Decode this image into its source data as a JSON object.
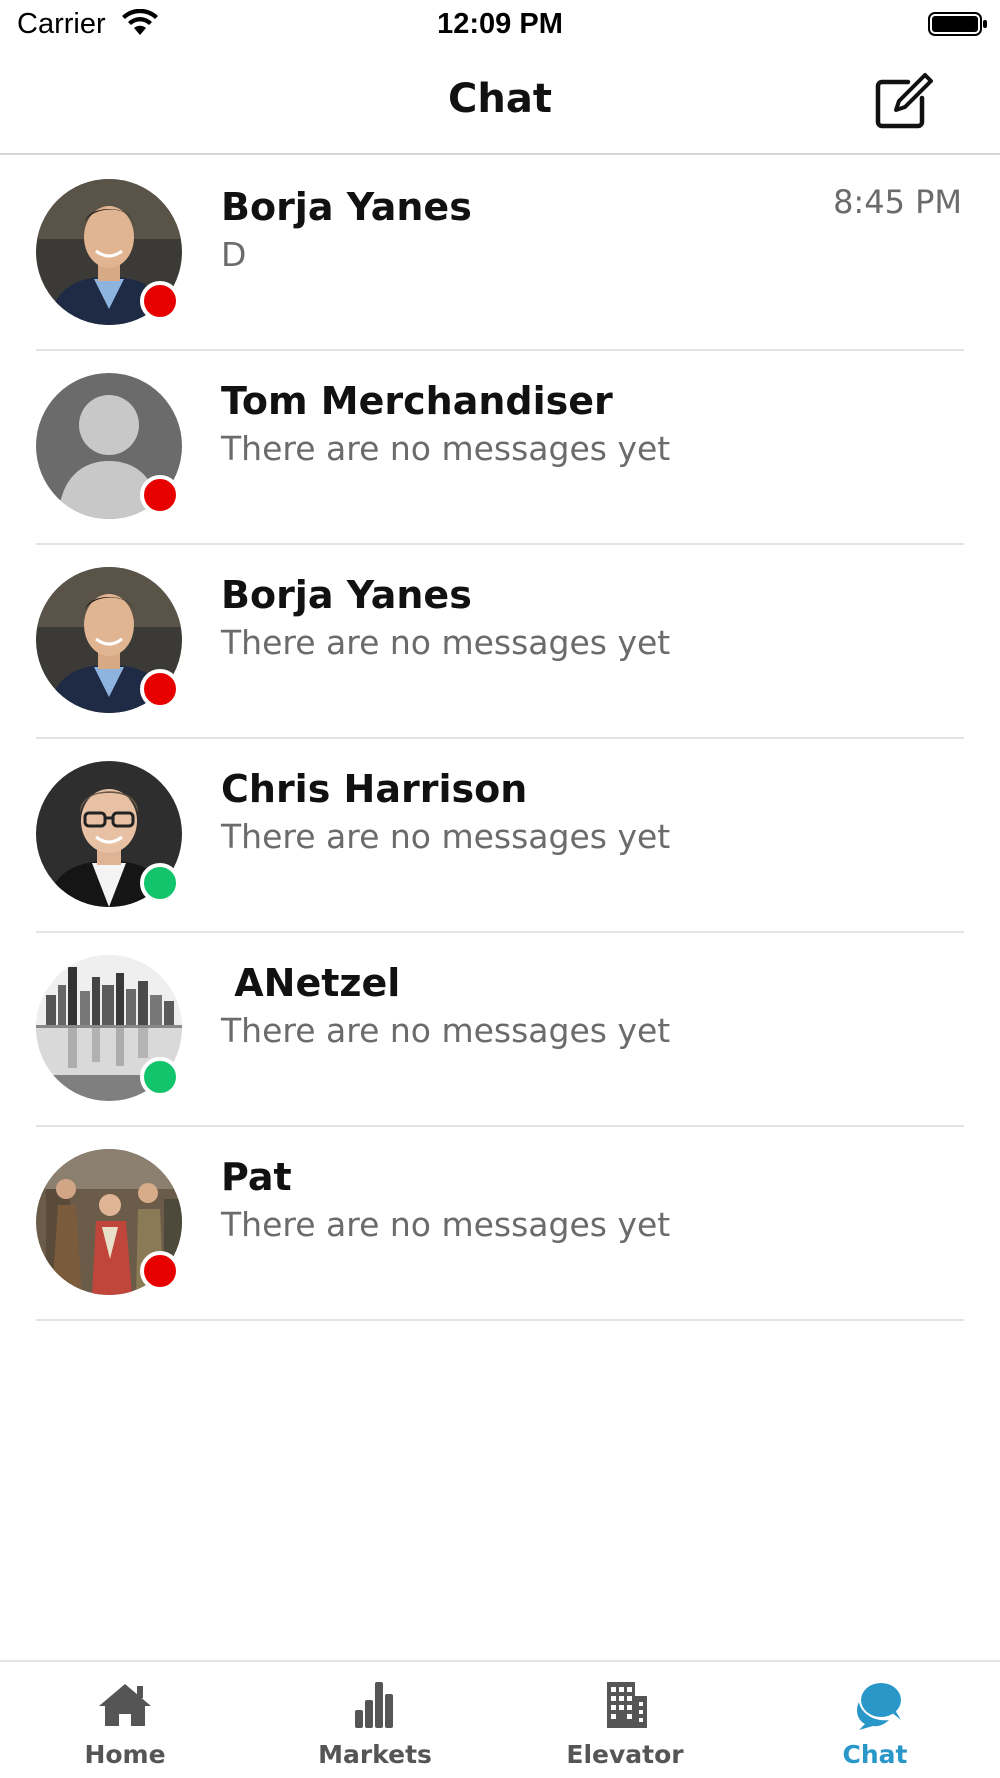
{
  "status_bar": {
    "carrier": "Carrier",
    "time": "12:09 PM"
  },
  "header": {
    "title": "Chat",
    "compose_icon": "compose-icon"
  },
  "colors": {
    "offline": "#e80000",
    "online": "#12c46b",
    "accent": "#2a97c9",
    "tab_inactive": "#555555"
  },
  "chats": [
    {
      "name": "Borja Yanes",
      "last_message": "D",
      "time": "8:45 PM",
      "status": "offline",
      "avatar": "person-photo-avatar"
    },
    {
      "name": "Tom Merchandiser",
      "last_message": "There are no messages yet",
      "time": "",
      "status": "offline",
      "avatar": "placeholder-avatar"
    },
    {
      "name": "Borja Yanes",
      "last_message": "There are no messages yet",
      "time": "",
      "status": "offline",
      "avatar": "person-photo-avatar"
    },
    {
      "name": "Chris Harrison",
      "last_message": "There are no messages yet",
      "time": "",
      "status": "online",
      "avatar": "person-photo-avatar"
    },
    {
      "name": " ANetzel",
      "last_message": "There are no messages yet",
      "time": "",
      "status": "online",
      "avatar": "city-skyline-avatar"
    },
    {
      "name": "Pat",
      "last_message": "There are no messages yet",
      "time": "",
      "status": "offline",
      "avatar": "group-photo-avatar"
    }
  ],
  "tabs": [
    {
      "label": "Home",
      "icon": "home-icon",
      "active": false
    },
    {
      "label": "Markets",
      "icon": "bar-chart-icon",
      "active": false
    },
    {
      "label": "Elevator",
      "icon": "building-icon",
      "active": false
    },
    {
      "label": "Chat",
      "icon": "chat-bubbles-icon",
      "active": true
    }
  ]
}
